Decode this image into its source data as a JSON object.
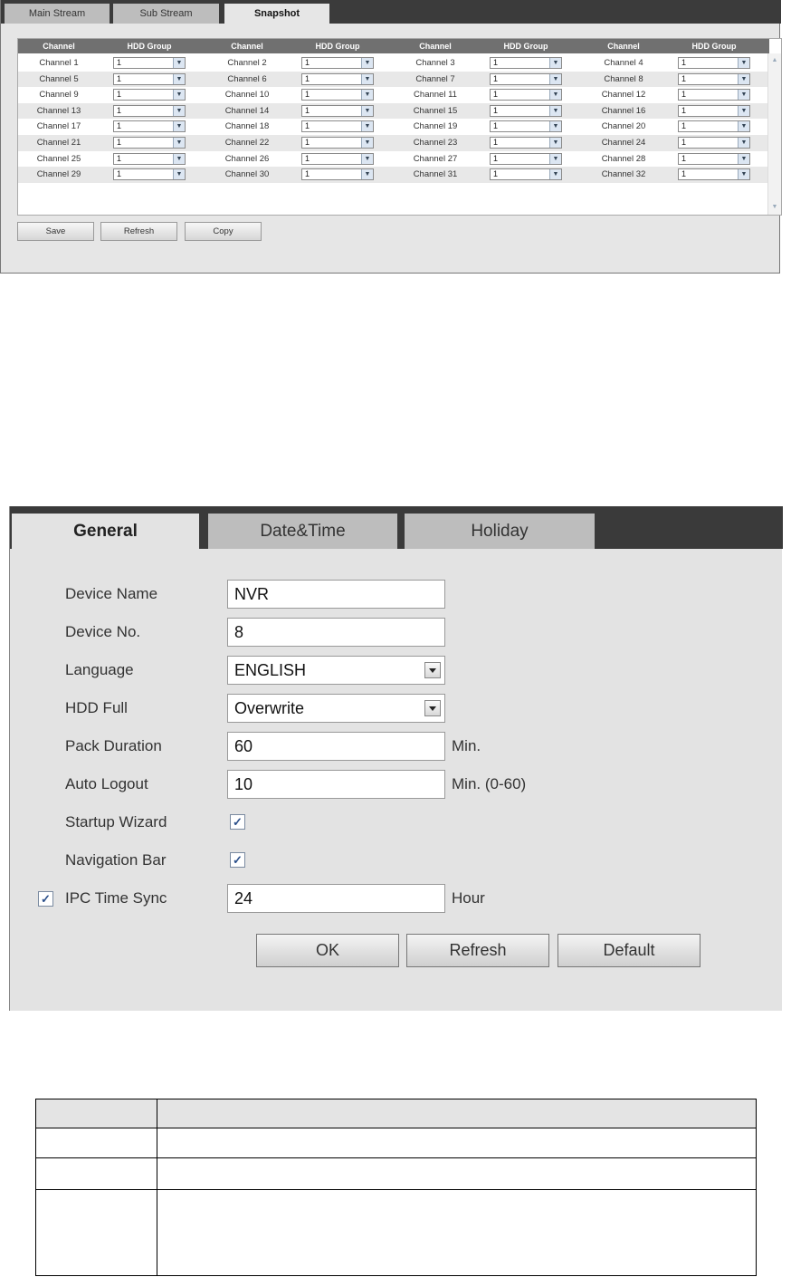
{
  "panel1": {
    "tabs": [
      {
        "label": "Main Stream",
        "active": false
      },
      {
        "label": "Sub Stream",
        "active": false
      },
      {
        "label": "Snapshot",
        "active": true
      }
    ],
    "headers": [
      "Channel",
      "HDD Group",
      "Channel",
      "HDD Group",
      "Channel",
      "HDD Group",
      "Channel",
      "HDD Group"
    ],
    "rows": [
      [
        {
          "channel": "Channel 1",
          "group": "1"
        },
        {
          "channel": "Channel 2",
          "group": "1"
        },
        {
          "channel": "Channel 3",
          "group": "1"
        },
        {
          "channel": "Channel 4",
          "group": "1"
        }
      ],
      [
        {
          "channel": "Channel 5",
          "group": "1"
        },
        {
          "channel": "Channel 6",
          "group": "1"
        },
        {
          "channel": "Channel 7",
          "group": "1"
        },
        {
          "channel": "Channel 8",
          "group": "1"
        }
      ],
      [
        {
          "channel": "Channel 9",
          "group": "1"
        },
        {
          "channel": "Channel 10",
          "group": "1"
        },
        {
          "channel": "Channel 11",
          "group": "1"
        },
        {
          "channel": "Channel 12",
          "group": "1"
        }
      ],
      [
        {
          "channel": "Channel 13",
          "group": "1"
        },
        {
          "channel": "Channel 14",
          "group": "1"
        },
        {
          "channel": "Channel 15",
          "group": "1"
        },
        {
          "channel": "Channel 16",
          "group": "1"
        }
      ],
      [
        {
          "channel": "Channel 17",
          "group": "1"
        },
        {
          "channel": "Channel 18",
          "group": "1"
        },
        {
          "channel": "Channel 19",
          "group": "1"
        },
        {
          "channel": "Channel 20",
          "group": "1"
        }
      ],
      [
        {
          "channel": "Channel 21",
          "group": "1"
        },
        {
          "channel": "Channel 22",
          "group": "1"
        },
        {
          "channel": "Channel 23",
          "group": "1"
        },
        {
          "channel": "Channel 24",
          "group": "1"
        }
      ],
      [
        {
          "channel": "Channel 25",
          "group": "1"
        },
        {
          "channel": "Channel 26",
          "group": "1"
        },
        {
          "channel": "Channel 27",
          "group": "1"
        },
        {
          "channel": "Channel 28",
          "group": "1"
        }
      ],
      [
        {
          "channel": "Channel 29",
          "group": "1"
        },
        {
          "channel": "Channel 30",
          "group": "1"
        },
        {
          "channel": "Channel 31",
          "group": "1"
        },
        {
          "channel": "Channel 32",
          "group": "1"
        }
      ]
    ],
    "buttons": {
      "save": "Save",
      "refresh": "Refresh",
      "copy": "Copy"
    }
  },
  "panel2": {
    "tabs": [
      {
        "label": "General",
        "active": true
      },
      {
        "label": "Date&Time",
        "active": false
      },
      {
        "label": "Holiday",
        "active": false
      }
    ],
    "fields": {
      "device_name": {
        "label": "Device Name",
        "value": "NVR"
      },
      "device_no": {
        "label": "Device No.",
        "value": "8"
      },
      "language": {
        "label": "Language",
        "value": "ENGLISH"
      },
      "hdd_full": {
        "label": "HDD Full",
        "value": "Overwrite"
      },
      "pack_duration": {
        "label": "Pack Duration",
        "value": "60",
        "unit": "Min."
      },
      "auto_logout": {
        "label": "Auto Logout",
        "value": "10",
        "unit": "Min. (0-60)"
      },
      "startup_wizard": {
        "label": "Startup Wizard",
        "checked": true
      },
      "navigation_bar": {
        "label": "Navigation Bar",
        "checked": true
      },
      "ipc_time_sync": {
        "label": "IPC Time Sync",
        "checked": true,
        "value": "24",
        "unit": "Hour"
      }
    },
    "check_glyph": "✓",
    "buttons": {
      "ok": "OK",
      "refresh": "Refresh",
      "default": "Default"
    }
  },
  "icons": {
    "dropdown": "chevron-down-icon",
    "check": "checkmark-icon",
    "scroll": "scroll-arrow-icon"
  }
}
